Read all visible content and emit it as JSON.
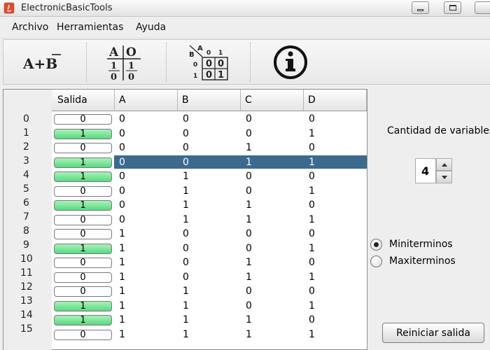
{
  "window": {
    "title": "ElectronicBasicTools"
  },
  "menu": {
    "items": [
      "Archivo",
      "Herramientas",
      "Ayuda"
    ]
  },
  "toolbar": {
    "tools": [
      {
        "name": "boolean-expression",
        "label": "A+B"
      },
      {
        "name": "truth-table",
        "header": [
          "A",
          "O"
        ],
        "rows": [
          [
            "1",
            "1"
          ],
          [
            "0",
            "0"
          ]
        ]
      },
      {
        "name": "karnaugh-map",
        "labels": [
          "B",
          "A",
          "0",
          "1"
        ],
        "rows": [
          [
            "0",
            "0",
            "0"
          ],
          [
            "1",
            "0",
            "1"
          ]
        ]
      },
      {
        "name": "info",
        "label": "i"
      }
    ]
  },
  "table": {
    "columns": [
      "Salida",
      "A",
      "B",
      "C",
      "D"
    ],
    "selected_row": 3,
    "rows": [
      {
        "index": "0",
        "salida": "0",
        "a": "0",
        "b": "0",
        "c": "0",
        "d": "0"
      },
      {
        "index": "1",
        "salida": "1",
        "a": "0",
        "b": "0",
        "c": "0",
        "d": "1"
      },
      {
        "index": "2",
        "salida": "0",
        "a": "0",
        "b": "0",
        "c": "1",
        "d": "0"
      },
      {
        "index": "3",
        "salida": "1",
        "a": "0",
        "b": "0",
        "c": "1",
        "d": "1"
      },
      {
        "index": "4",
        "salida": "1",
        "a": "0",
        "b": "1",
        "c": "0",
        "d": "0"
      },
      {
        "index": "5",
        "salida": "0",
        "a": "0",
        "b": "1",
        "c": "0",
        "d": "1"
      },
      {
        "index": "6",
        "salida": "1",
        "a": "0",
        "b": "1",
        "c": "1",
        "d": "0"
      },
      {
        "index": "7",
        "salida": "0",
        "a": "0",
        "b": "1",
        "c": "1",
        "d": "1"
      },
      {
        "index": "8",
        "salida": "0",
        "a": "1",
        "b": "0",
        "c": "0",
        "d": "0"
      },
      {
        "index": "9",
        "salida": "1",
        "a": "1",
        "b": "0",
        "c": "0",
        "d": "1"
      },
      {
        "index": "10",
        "salida": "0",
        "a": "1",
        "b": "0",
        "c": "1",
        "d": "0"
      },
      {
        "index": "11",
        "salida": "0",
        "a": "1",
        "b": "0",
        "c": "1",
        "d": "1"
      },
      {
        "index": "12",
        "salida": "0",
        "a": "1",
        "b": "1",
        "c": "0",
        "d": "0"
      },
      {
        "index": "13",
        "salida": "1",
        "a": "1",
        "b": "1",
        "c": "0",
        "d": "1"
      },
      {
        "index": "14",
        "salida": "1",
        "a": "1",
        "b": "1",
        "c": "1",
        "d": "0"
      },
      {
        "index": "15",
        "salida": "0",
        "a": "1",
        "b": "1",
        "c": "1",
        "d": "1"
      }
    ]
  },
  "panel": {
    "variables_label": "Cantidad de variables",
    "variables_value": "4",
    "radios": [
      {
        "label": "Miniterminos",
        "selected": true
      },
      {
        "label": "Maxiterminos",
        "selected": false
      }
    ],
    "reset_label": "Reiniciar salida"
  },
  "colors": {
    "selection": "#3c6a8e",
    "salida_on": "#58d981"
  }
}
